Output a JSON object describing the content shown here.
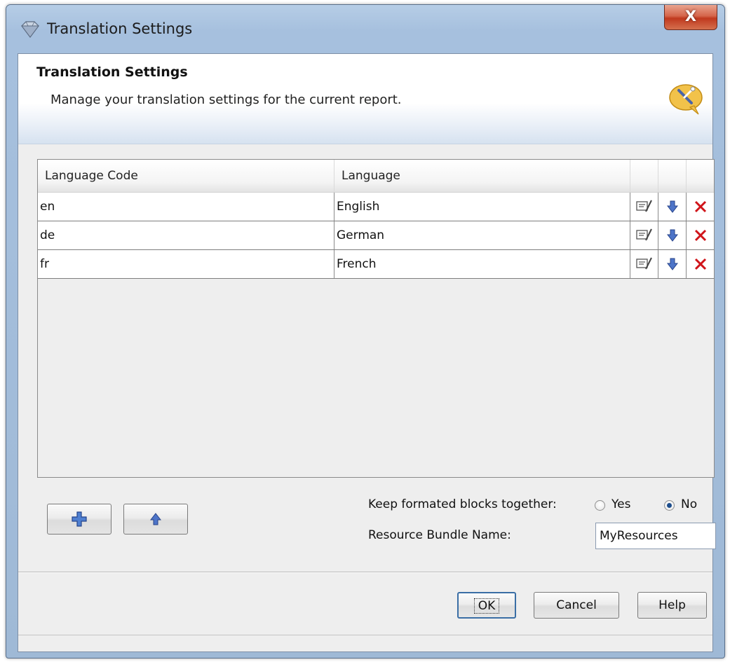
{
  "window": {
    "title": "Translation Settings",
    "close_label": "X"
  },
  "banner": {
    "title": "Translation Settings",
    "description": "Manage your translation settings for the current report."
  },
  "table": {
    "columns": [
      "Language Code",
      "Language"
    ],
    "rows": [
      {
        "code": "en",
        "language": "English"
      },
      {
        "code": "de",
        "language": "German"
      },
      {
        "code": "fr",
        "language": "French"
      }
    ],
    "row_actions": [
      "edit-icon",
      "move-down-icon",
      "delete-icon"
    ]
  },
  "options": {
    "keep_blocks_label": "Keep formated blocks together:",
    "yes_label": "Yes",
    "no_label": "No",
    "keep_blocks_selected": "No",
    "bundle_label": "Resource Bundle Name:",
    "bundle_value": "MyResources"
  },
  "buttons": {
    "ok": "OK",
    "cancel": "Cancel",
    "help": "Help"
  },
  "colors": {
    "accent": "#3a6ea5",
    "delete": "#d0141a",
    "arrow": "#3b5fb0"
  }
}
